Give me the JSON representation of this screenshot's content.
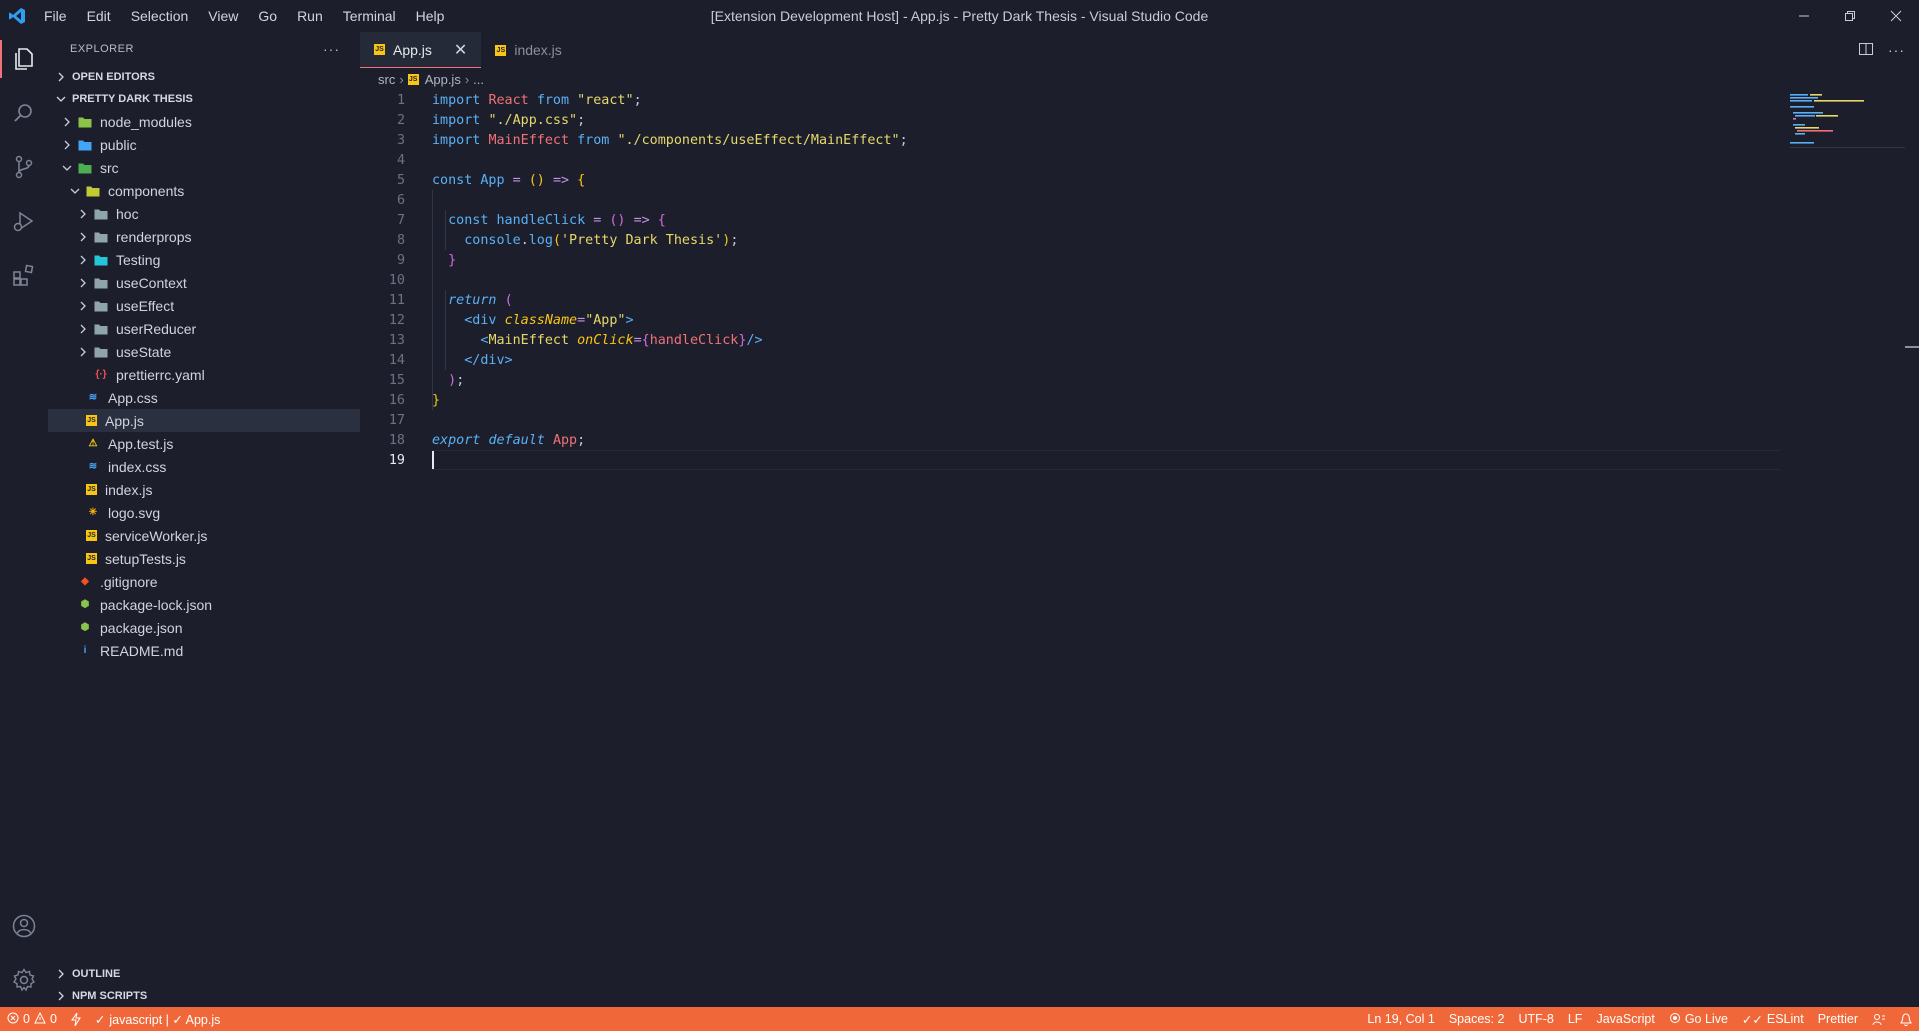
{
  "titlebar": {
    "menu": [
      "File",
      "Edit",
      "Selection",
      "View",
      "Go",
      "Run",
      "Terminal",
      "Help"
    ],
    "title": "[Extension Development Host] - App.js - Pretty Dark Thesis - Visual Studio Code"
  },
  "sidebar": {
    "header": "EXPLORER",
    "more": "···",
    "open_editors": "OPEN EDITORS",
    "project": "PRETTY DARK THESIS",
    "tree": [
      {
        "label": "node_modules",
        "depth": 1,
        "kind": "folder",
        "expanded": false,
        "icon": "folder-node-icon",
        "color": "#8bc34a"
      },
      {
        "label": "public",
        "depth": 1,
        "kind": "folder",
        "expanded": false,
        "icon": "folder-public-icon",
        "color": "#42a5f5"
      },
      {
        "label": "src",
        "depth": 1,
        "kind": "folder",
        "expanded": true,
        "icon": "folder-src-icon",
        "color": "#4caf50"
      },
      {
        "label": "components",
        "depth": 2,
        "kind": "folder",
        "expanded": true,
        "icon": "folder-components-icon",
        "color": "#c0ca33"
      },
      {
        "label": "hoc",
        "depth": 3,
        "kind": "folder",
        "expanded": false,
        "icon": "folder-icon",
        "color": "#90a4ae"
      },
      {
        "label": "renderprops",
        "depth": 3,
        "kind": "folder",
        "expanded": false,
        "icon": "folder-icon",
        "color": "#90a4ae"
      },
      {
        "label": "Testing",
        "depth": 3,
        "kind": "folder",
        "expanded": false,
        "icon": "folder-test-icon",
        "color": "#26c6da"
      },
      {
        "label": "useContext",
        "depth": 3,
        "kind": "folder",
        "expanded": false,
        "icon": "folder-icon",
        "color": "#90a4ae"
      },
      {
        "label": "useEffect",
        "depth": 3,
        "kind": "folder",
        "expanded": false,
        "icon": "folder-icon",
        "color": "#90a4ae"
      },
      {
        "label": "userReducer",
        "depth": 3,
        "kind": "folder",
        "expanded": false,
        "icon": "folder-icon",
        "color": "#90a4ae"
      },
      {
        "label": "useState",
        "depth": 3,
        "kind": "folder",
        "expanded": false,
        "icon": "folder-icon",
        "color": "#90a4ae"
      },
      {
        "label": "prettierrc.yaml",
        "depth": 3,
        "kind": "file",
        "icon": "yaml-file-icon",
        "glyph": "{·}",
        "color": "#ef5350"
      },
      {
        "label": "App.css",
        "depth": 2,
        "kind": "file",
        "icon": "css-file-icon",
        "glyph": "≋",
        "color": "#42a5f5"
      },
      {
        "label": "App.js",
        "depth": 2,
        "kind": "file",
        "icon": "js-file-icon",
        "glyph": "JS",
        "color": "#f9c513",
        "selected": true
      },
      {
        "label": "App.test.js",
        "depth": 2,
        "kind": "file",
        "icon": "test-file-icon",
        "glyph": "⚠",
        "color": "#f9c513"
      },
      {
        "label": "index.css",
        "depth": 2,
        "kind": "file",
        "icon": "css-file-icon",
        "glyph": "≋",
        "color": "#42a5f5"
      },
      {
        "label": "index.js",
        "depth": 2,
        "kind": "file",
        "icon": "js-file-icon",
        "glyph": "JS",
        "color": "#f9c513"
      },
      {
        "label": "logo.svg",
        "depth": 2,
        "kind": "file",
        "icon": "svg-file-icon",
        "glyph": "✳",
        "color": "#ffb300"
      },
      {
        "label": "serviceWorker.js",
        "depth": 2,
        "kind": "file",
        "icon": "js-file-icon",
        "glyph": "JS",
        "color": "#f9c513"
      },
      {
        "label": "setupTests.js",
        "depth": 2,
        "kind": "file",
        "icon": "js-file-icon",
        "glyph": "JS",
        "color": "#f9c513"
      },
      {
        "label": ".gitignore",
        "depth": 1,
        "kind": "file",
        "icon": "git-file-icon",
        "glyph": "◆",
        "color": "#f4511e"
      },
      {
        "label": "package-lock.json",
        "depth": 1,
        "kind": "file",
        "icon": "npm-lock-icon",
        "glyph": "⬢",
        "color": "#8bc34a"
      },
      {
        "label": "package.json",
        "depth": 1,
        "kind": "file",
        "icon": "npm-file-icon",
        "glyph": "⬢",
        "color": "#8bc34a"
      },
      {
        "label": "README.md",
        "depth": 1,
        "kind": "file",
        "icon": "info-file-icon",
        "glyph": "i",
        "color": "#42a5f5"
      }
    ],
    "outline": "OUTLINE",
    "npm_scripts": "NPM SCRIPTS"
  },
  "editor": {
    "tabs": [
      {
        "label": "App.js",
        "active": true
      },
      {
        "label": "index.js",
        "active": false
      }
    ],
    "breadcrumb": {
      "folder": "src",
      "file": "App.js",
      "symbol": "..."
    },
    "current_line": 19,
    "lines": [
      [
        [
          "import ",
          "kw"
        ],
        [
          "React ",
          "red"
        ],
        [
          "from ",
          "kw"
        ],
        [
          "\"react\"",
          "str"
        ],
        [
          ";",
          "plain"
        ]
      ],
      [
        [
          "import ",
          "kw"
        ],
        [
          "\"./App.css\"",
          "str"
        ],
        [
          ";",
          "plain"
        ]
      ],
      [
        [
          "import ",
          "kw"
        ],
        [
          "MainEffect ",
          "red"
        ],
        [
          "from ",
          "kw"
        ],
        [
          "\"./components/useEffect/MainEffect\"",
          "str"
        ],
        [
          ";",
          "plain"
        ]
      ],
      [],
      [
        [
          "const ",
          "kw"
        ],
        [
          "App ",
          "var"
        ],
        [
          "= ",
          "op"
        ],
        [
          "() ",
          "br"
        ],
        [
          "=> ",
          "op"
        ],
        [
          "{",
          "br"
        ]
      ],
      [],
      [
        [
          "  const ",
          "kw"
        ],
        [
          "handleClick ",
          "var"
        ],
        [
          "= ",
          "op"
        ],
        [
          "() ",
          "br2"
        ],
        [
          "=> ",
          "op"
        ],
        [
          "{",
          "br2"
        ]
      ],
      [
        [
          "    console",
          "var"
        ],
        [
          ".",
          "plain"
        ],
        [
          "log",
          "var"
        ],
        [
          "(",
          "br"
        ],
        [
          "'Pretty Dark Thesis'",
          "str"
        ],
        [
          ")",
          "br"
        ],
        [
          ";",
          "plain"
        ]
      ],
      [
        [
          "  }",
          "br2"
        ]
      ],
      [],
      [
        [
          "  return ",
          "kwi"
        ],
        [
          "(",
          "br2"
        ]
      ],
      [
        [
          "    <div ",
          "tag"
        ],
        [
          "className",
          "attr"
        ],
        [
          "=",
          "op"
        ],
        [
          "\"App\"",
          "str"
        ],
        [
          ">",
          "tag"
        ]
      ],
      [
        [
          "      <",
          "tag"
        ],
        [
          "MainEffect ",
          "str"
        ],
        [
          "onClick",
          "attr"
        ],
        [
          "=",
          "op"
        ],
        [
          "{",
          "br2"
        ],
        [
          "handleClick",
          "red"
        ],
        [
          "}",
          "br2"
        ],
        [
          "/>",
          "tag"
        ]
      ],
      [
        [
          "    </div>",
          "tag"
        ]
      ],
      [
        [
          "  )",
          "br2"
        ],
        [
          ";",
          "plain"
        ]
      ],
      [
        [
          "}",
          "br"
        ]
      ],
      [],
      [
        [
          "export ",
          "kwi"
        ],
        [
          "default ",
          "kwi"
        ],
        [
          "App",
          "red"
        ],
        [
          ";",
          "plain"
        ]
      ],
      []
    ],
    "syntax_colors": {
      "kw": "#5ab0f6",
      "kwi": "#5ab0f6",
      "red": "#f07178",
      "str": "#e6d86a",
      "var": "#5ab0f6",
      "op": "#c792ea",
      "br": "#f9c513",
      "br2": "#d36ae0",
      "tag": "#5ab0f6",
      "attr": "#f9c513",
      "plain": "#c8ccd8"
    }
  },
  "statusbar": {
    "errors": "0",
    "warnings": "0",
    "lang_check": "javascript | ✓ App.js",
    "position": "Ln 19, Col 1",
    "spaces": "Spaces: 2",
    "encoding": "UTF-8",
    "eol": "LF",
    "language": "JavaScript",
    "golive": "Go Live",
    "eslint": "ESLint",
    "prettier": "Prettier",
    "bg_color": "#f0683a"
  }
}
